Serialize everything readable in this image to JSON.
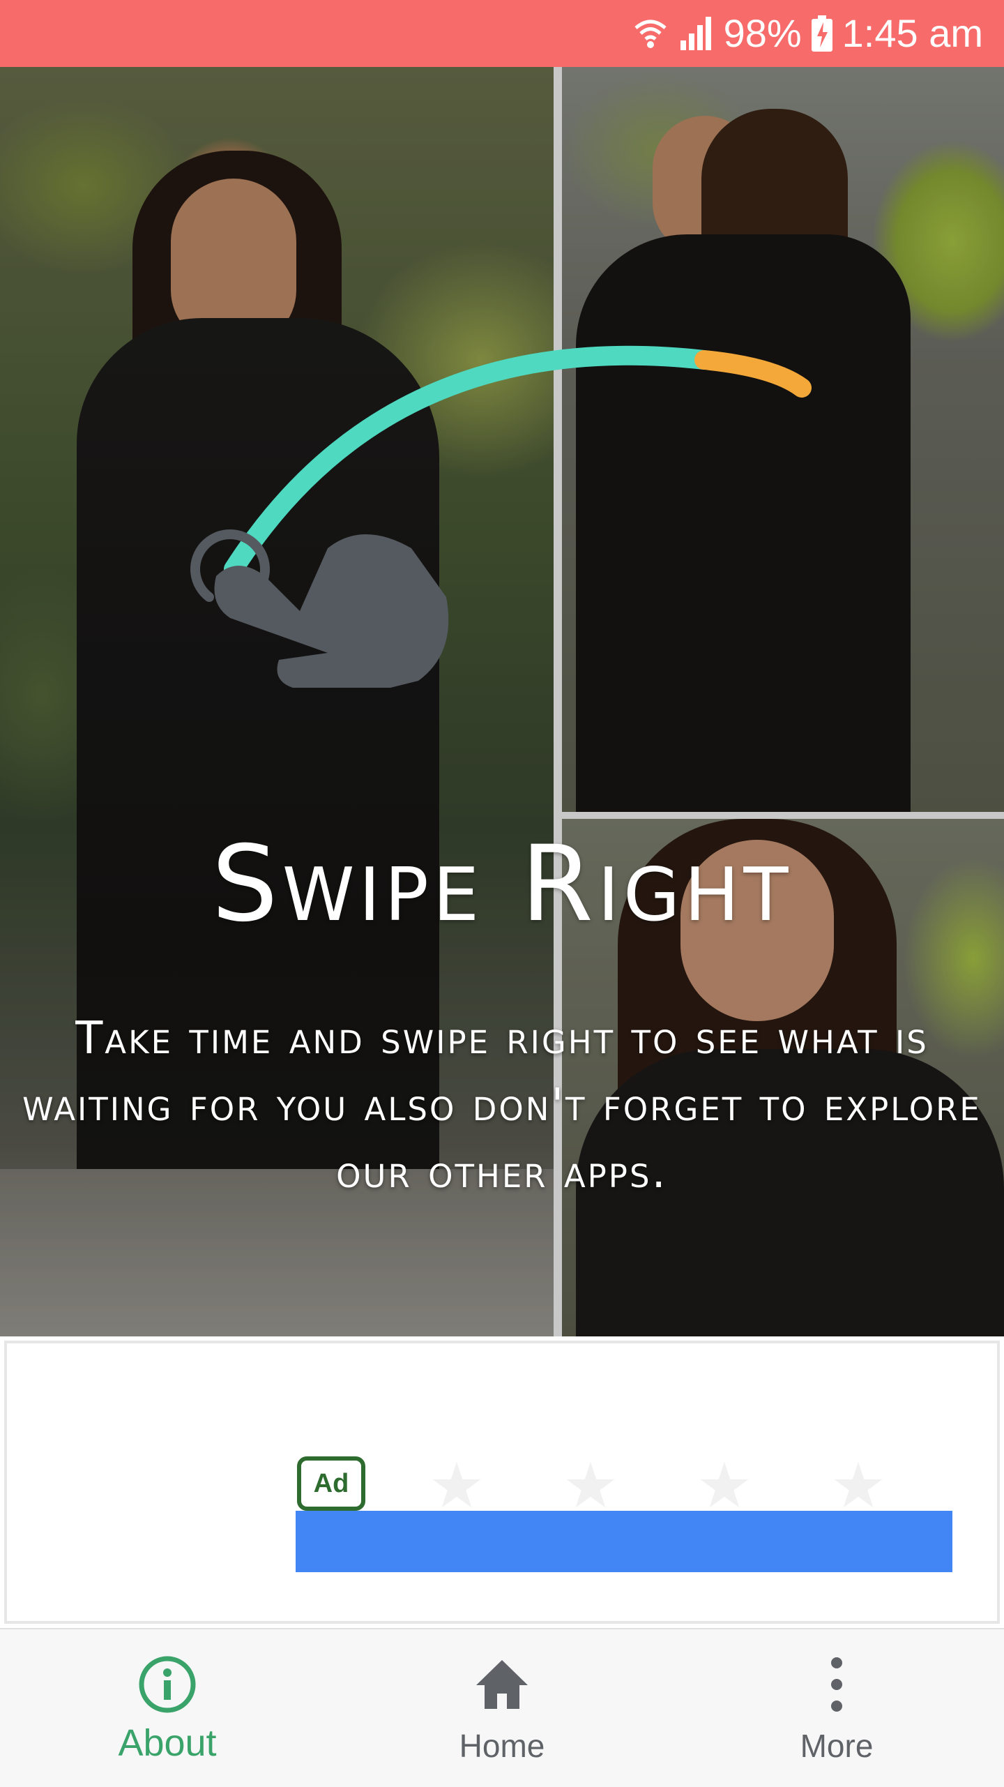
{
  "status_bar": {
    "battery": "98%",
    "time": "1:45 am",
    "icons": [
      "wifi-icon",
      "signal-icon",
      "battery-charging-icon"
    ]
  },
  "intro": {
    "headline": "Swipe Right",
    "description": "Take time and swipe right to see what is waiting for you also don't forget to explore our other apps.",
    "gesture_colors": {
      "arc_primary": "#4fd9c1",
      "arc_tip": "#f5a83a",
      "hand": "#545a60"
    }
  },
  "ad": {
    "badge": "Ad",
    "bar_color": "#4285f4"
  },
  "bottom_nav": {
    "items": [
      {
        "label": "About",
        "icon": "info-icon",
        "active": true
      },
      {
        "label": "Home",
        "icon": "home-icon",
        "active": false
      },
      {
        "label": "More",
        "icon": "more-vertical-icon",
        "active": false
      }
    ],
    "active_color": "#3aa36a",
    "inactive_color": "#5f6368"
  },
  "colors": {
    "status_bar": "#f76b6b"
  }
}
